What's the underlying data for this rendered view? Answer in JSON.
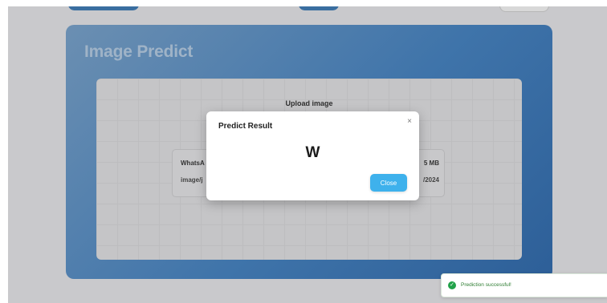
{
  "panel": {
    "title": "Image Predict"
  },
  "upload": {
    "label": "Upload image",
    "file": {
      "name_visible": "WhatsA",
      "type_visible": "image/j",
      "size_visible": "5 MB",
      "date_visible": "/2024"
    }
  },
  "modal": {
    "title": "Predict Result",
    "close_glyph": "×",
    "result": "W",
    "close_button_label": "Close"
  },
  "toast": {
    "icon": "check-circle-icon",
    "message": "Prediction successful!"
  },
  "colors": {
    "accent": "#3eb1ec",
    "success": "#22a24a",
    "panel": "#3f74aa"
  }
}
